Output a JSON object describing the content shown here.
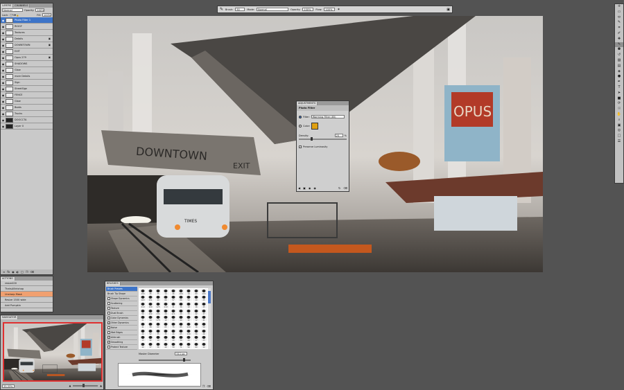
{
  "options_bar": {
    "brush_label": "Brush:",
    "brush_size": "50",
    "mode_label": "Mode:",
    "mode_value": "Normal",
    "opacity_label": "Opacity:",
    "opacity_value": "100%",
    "flow_label": "Flow:",
    "flow_value": "100%"
  },
  "layers_panel": {
    "tabs": [
      "LAYERS",
      "CHANNELS"
    ],
    "blend_mode": "Normal",
    "opacity_label": "Opacity:",
    "opacity_value": "100%",
    "lock_label": "Lock:",
    "fill_label": "Fill:",
    "fill_value": "100%",
    "layers": [
      {
        "name": "Photo Filter 1",
        "selected": true
      },
      {
        "name": "RIGGF"
      },
      {
        "name": "Textures"
      },
      {
        "name": "Details"
      },
      {
        "name": "DOWNTOWN"
      },
      {
        "name": "EXIT"
      },
      {
        "name": "Opus 279"
      },
      {
        "name": "SHADOWS"
      },
      {
        "name": "Glow"
      },
      {
        "name": "more Details"
      },
      {
        "name": "Sign"
      },
      {
        "name": "StreetSign"
      },
      {
        "name": "FENCE"
      },
      {
        "name": "Glow"
      },
      {
        "name": "Boats"
      },
      {
        "name": "Trucks"
      },
      {
        "name": "DOOCCTA"
      },
      {
        "name": "Layer 0"
      }
    ]
  },
  "actions_panel": {
    "title": "ACTIONS",
    "items": [
      "resize400",
      "ThatsAllIntshop",
      "Unsharp Mask",
      "Resize 1500 wide",
      "Add Pumpkin"
    ],
    "highlighted_index": 2
  },
  "navigator_panel": {
    "title": "NAVIGATOR",
    "zoom": "33.33%"
  },
  "adjustments_panel": {
    "title": "ADJUSTMENTS",
    "subtitle": "Photo Filter",
    "filter_label": "Filter:",
    "filter_value": "Warming Filter (85)",
    "color_label": "Color:",
    "color_swatch": "#e0a010",
    "density_label": "Density:",
    "density_value": "25",
    "density_unit": "%",
    "density_fraction": 0.25,
    "preserve_label": "Preserve Luminosity"
  },
  "brushes_panel": {
    "title": "BRUSHES",
    "options": [
      {
        "label": "Brush Presets",
        "selected": true,
        "checkbox": false
      },
      {
        "label": "Brush Tip Shape",
        "checkbox": false
      },
      {
        "label": "Shape Dynamics",
        "checked": false,
        "checkbox": true
      },
      {
        "label": "Scattering",
        "checked": false,
        "checkbox": true
      },
      {
        "label": "Texture",
        "checked": false,
        "checkbox": true
      },
      {
        "label": "Dual Brush",
        "checked": false,
        "checkbox": true
      },
      {
        "label": "Color Dynamics",
        "checked": false,
        "checkbox": true
      },
      {
        "label": "Other Dynamics",
        "checked": true,
        "checkbox": true
      },
      {
        "label": "Noise",
        "checked": false,
        "checkbox": true
      },
      {
        "label": "Wet Edges",
        "checked": false,
        "checkbox": true
      },
      {
        "label": "Airbrush",
        "checked": true,
        "checkbox": true
      },
      {
        "label": "Smoothing",
        "checked": true,
        "checkbox": true
      },
      {
        "label": "Protect Texture",
        "checked": false,
        "checkbox": true
      }
    ],
    "presets": [
      "100",
      "45",
      "35",
      "14",
      "46",
      "100",
      "19",
      "60",
      "100",
      "163",
      "151",
      "49",
      "66",
      "57",
      "66",
      "50",
      "20",
      "25",
      "210",
      "100",
      "125",
      "119",
      "41",
      "36",
      "19",
      "16",
      "45",
      "50",
      "102",
      "131",
      "29",
      "121",
      "20",
      "33",
      "42",
      "37",
      "21",
      "14",
      "175",
      "10",
      "33",
      "40",
      "32",
      "12",
      "41",
      "41",
      "38",
      "60",
      "65",
      "75",
      "85",
      "100",
      "16",
      "59",
      "20",
      "52",
      "35",
      "35",
      "26",
      "65",
      "100",
      "56",
      "26",
      "13",
      "32",
      "19",
      "33",
      "20",
      "30",
      "44",
      "17",
      "23",
      "40",
      "37",
      "36",
      "49",
      "58",
      "71",
      "56",
      "60",
      "40"
    ],
    "diameter_label": "Master Diameter",
    "diameter_value": "511 px"
  },
  "tools": [
    "move",
    "marquee",
    "lasso",
    "quick-select",
    "crop",
    "eyedropper",
    "heal",
    "brush",
    "stamp",
    "history",
    "eraser",
    "gradient",
    "blur",
    "dodge",
    "pen",
    "type",
    "path-select",
    "shape",
    "3d-rotate",
    "3d-orbit",
    "hand",
    "zoom",
    "fg-bg",
    "quickmask",
    "screen-mode",
    "extras"
  ],
  "canvas_art": {
    "sign_text": "DOWNTOWN",
    "exit_text": "EXIT",
    "bus_plate": "TIMES",
    "store_text": "OPUS"
  }
}
